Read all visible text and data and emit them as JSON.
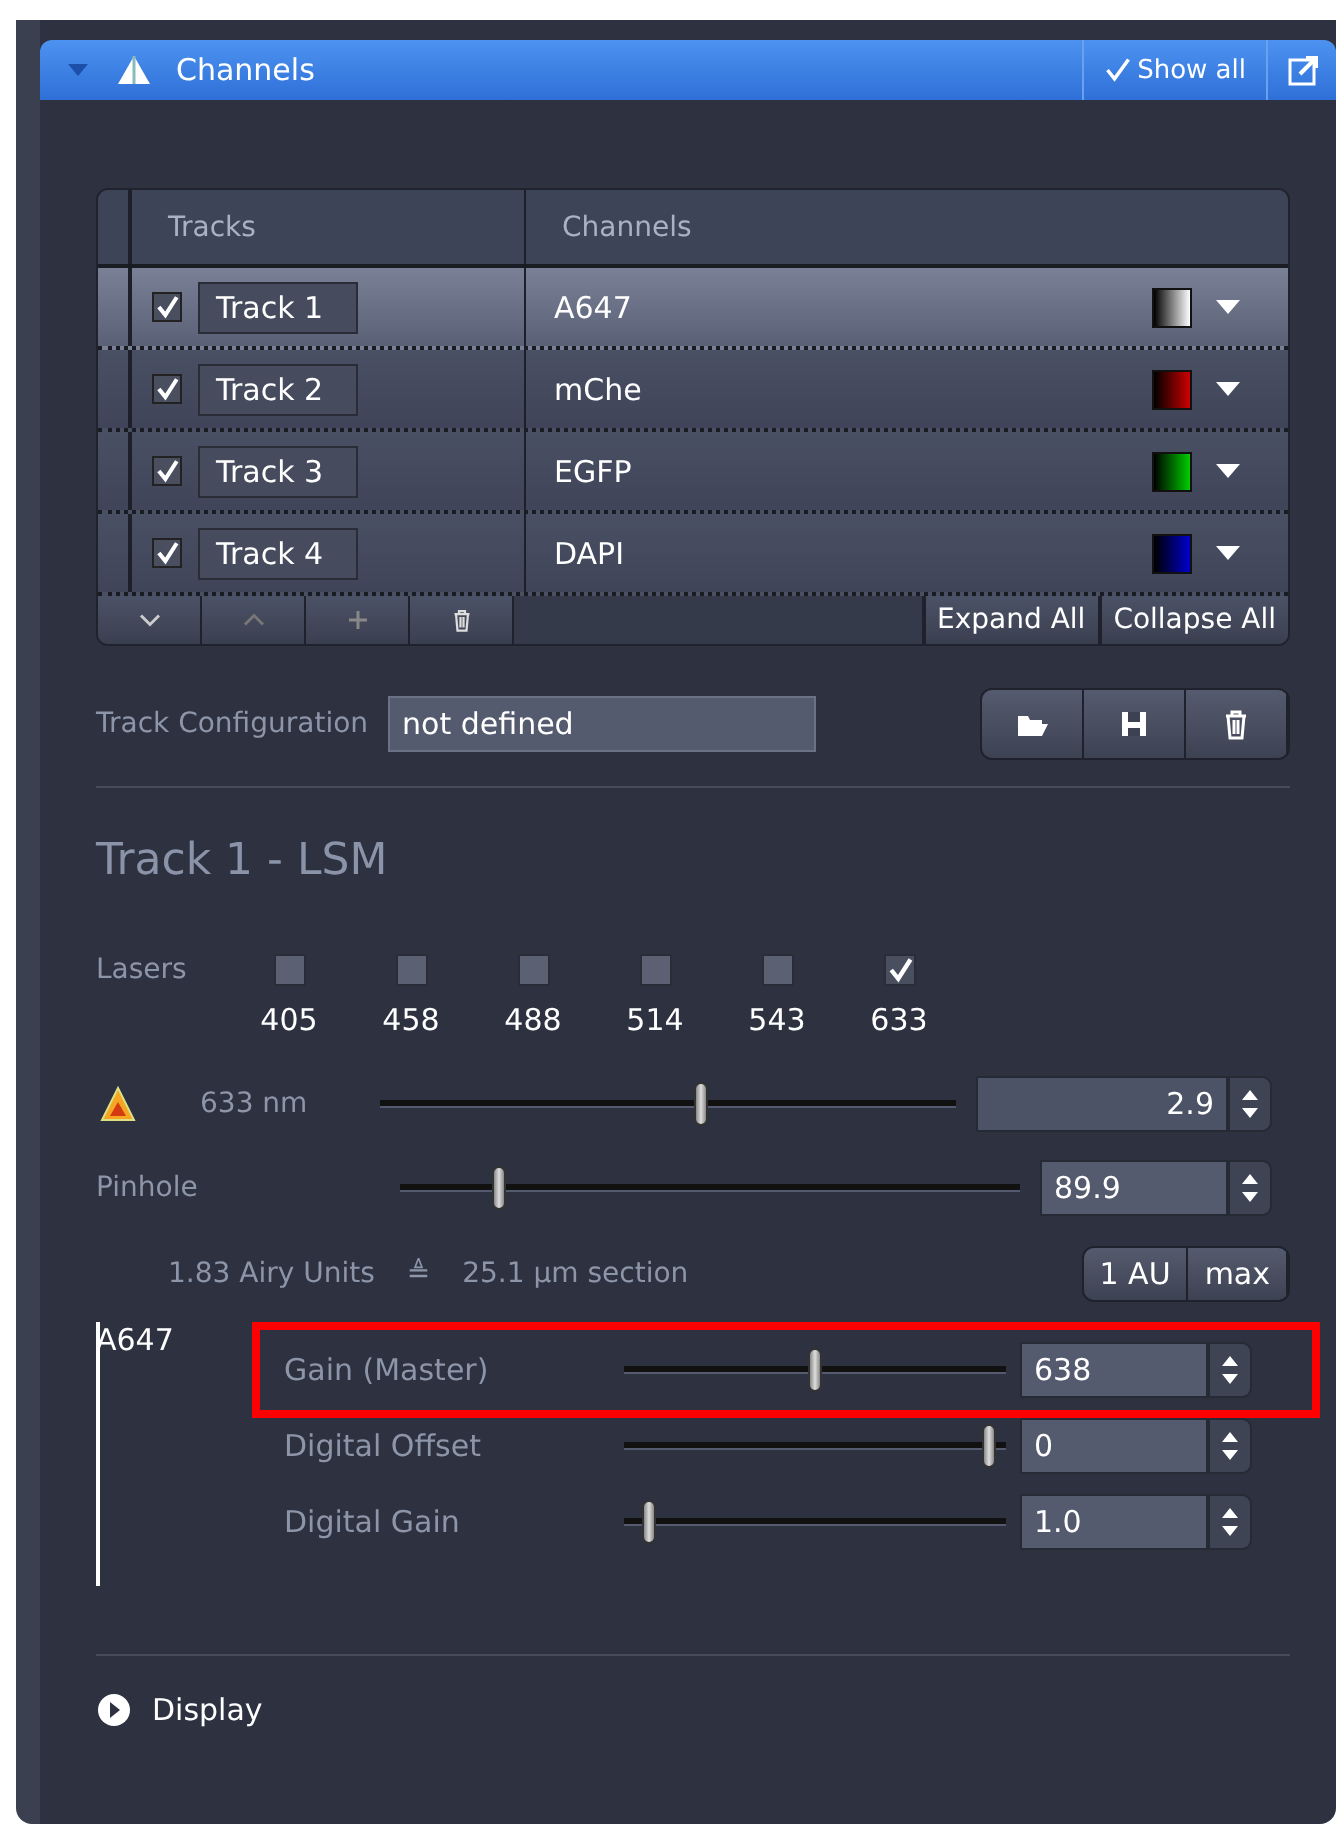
{
  "panel": {
    "title": "Channels",
    "show_all": {
      "label": "Show all",
      "checked": true
    }
  },
  "table": {
    "columns": [
      "Tracks",
      "Channels"
    ],
    "rows": [
      {
        "checked": true,
        "track": "Track 1",
        "channel": "A647",
        "color": "#ffffff",
        "selected": true
      },
      {
        "checked": true,
        "track": "Track 2",
        "channel": "mChe",
        "color": "#cc0000",
        "selected": false
      },
      {
        "checked": true,
        "track": "Track 3",
        "channel": "EGFP",
        "color": "#00cc00",
        "selected": false
      },
      {
        "checked": true,
        "track": "Track 4",
        "channel": "DAPI",
        "color": "#0000cc",
        "selected": false
      }
    ],
    "buttons": [
      "Expand All",
      "Collapse All"
    ]
  },
  "track_configuration": {
    "label": "Track Configuration",
    "value": "not defined"
  },
  "section_title": "Track 1 - LSM",
  "lasers": {
    "label": "Lasers",
    "items": [
      {
        "label": "405",
        "checked": false
      },
      {
        "label": "458",
        "checked": false
      },
      {
        "label": "488",
        "checked": false
      },
      {
        "label": "514",
        "checked": false
      },
      {
        "label": "543",
        "checked": false
      },
      {
        "label": "633",
        "checked": true
      }
    ]
  },
  "laser_power": {
    "label": "633 nm",
    "level": 0.56,
    "value": "2.9"
  },
  "pinhole": {
    "label": "Pinhole",
    "level": 0.16,
    "value": "89.9",
    "airy_units": "1.83 Airy Units",
    "equals_sign": "≜",
    "section": "25.1 µm section",
    "buttons": [
      "1 AU",
      "max"
    ]
  },
  "detector": {
    "channel": "A647",
    "controls": [
      {
        "label": "Gain (Master)",
        "level": 0.5,
        "value": "638",
        "highlighted": true
      },
      {
        "label": "Digital Offset",
        "level": 0.96,
        "value": "0",
        "highlighted": false
      },
      {
        "label": "Digital Gain",
        "level": 0.07,
        "value": "1.0",
        "highlighted": false
      }
    ]
  },
  "display": {
    "label": "Display",
    "expanded": false
  }
}
